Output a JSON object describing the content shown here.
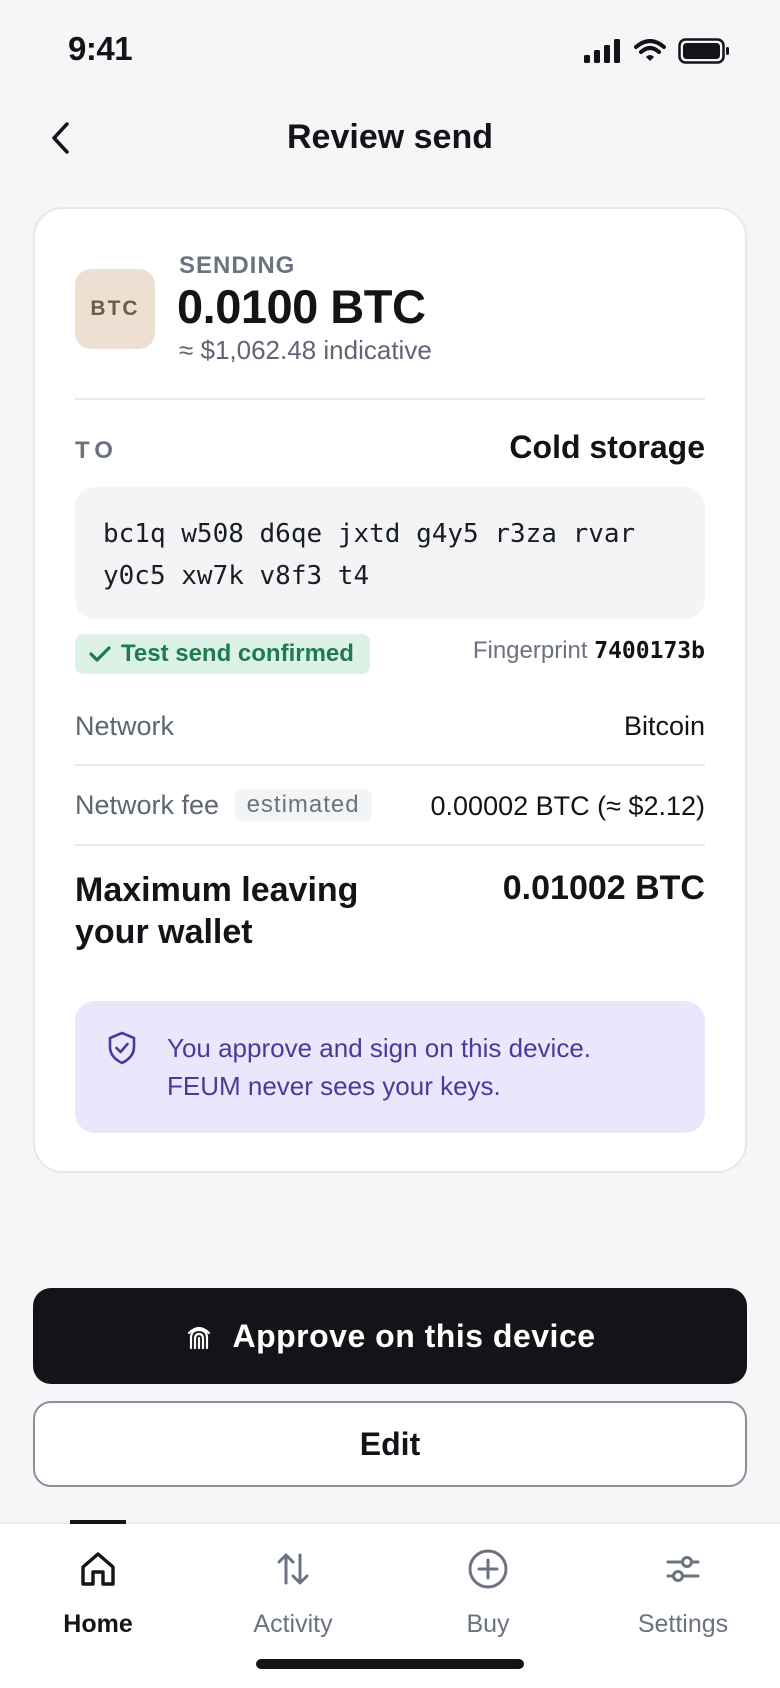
{
  "status_bar": {
    "time": "9:41"
  },
  "header": {
    "title": "Review send",
    "back_icon": "chevron-left-icon"
  },
  "send": {
    "asset_badge": "BTC",
    "label": "SENDING",
    "amount": "0.0100 BTC",
    "fiat": "≈ $1,062.48 indicative"
  },
  "recipient": {
    "to_label": "TO",
    "name": "Cold storage",
    "address_line1": "bc1q w508 d6qe jxtd g4y5 r3za rvar",
    "address_line2": "y0c5 xw7k v8f3 t4",
    "test_send": "Test send confirmed",
    "fingerprint_label": "Fingerprint",
    "fingerprint": "7400173b"
  },
  "details": {
    "network_label": "Network",
    "network_value": "Bitcoin",
    "fee_label": "Network fee",
    "fee_tag": "estimated",
    "fee_value": "0.00002 BTC (≈ $2.12)",
    "max_label": "Maximum leaving your wallet",
    "max_value": "0.01002 BTC"
  },
  "notice": {
    "icon": "shield-check-icon",
    "text_line1": "You approve and sign on this device.",
    "text_line2": "FEUM never sees your keys."
  },
  "actions": {
    "approve_label": "Approve on this device",
    "approve_icon": "fingerprint-icon",
    "edit_label": "Edit"
  },
  "tabs": [
    {
      "label": "Home",
      "icon": "home-icon",
      "active": true
    },
    {
      "label": "Activity",
      "icon": "arrows-up-down-icon",
      "active": false
    },
    {
      "label": "Buy",
      "icon": "plus-circle-icon",
      "active": false
    },
    {
      "label": "Settings",
      "icon": "sliders-icon",
      "active": false
    }
  ]
}
